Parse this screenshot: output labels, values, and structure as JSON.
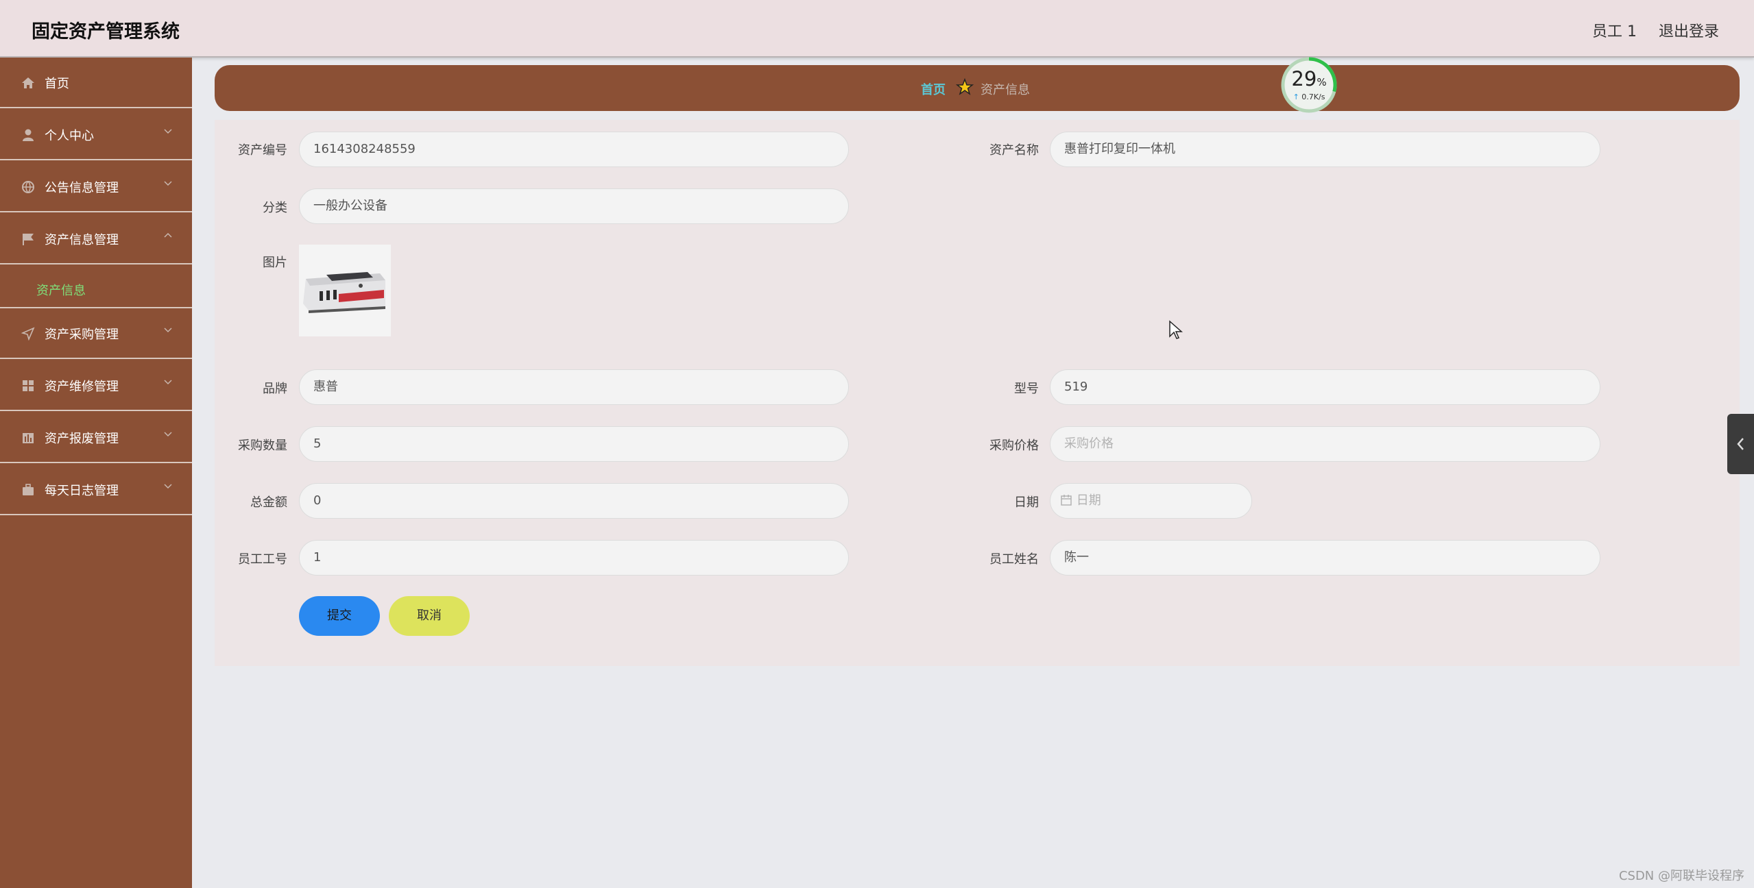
{
  "header": {
    "title": "固定资产管理系统",
    "user": "员工 1",
    "logout": "退出登录"
  },
  "sidebar": {
    "items": [
      {
        "label": "首页",
        "icon": "home-icon"
      },
      {
        "label": "个人中心",
        "icon": "user-icon"
      },
      {
        "label": "公告信息管理",
        "icon": "globe-icon"
      },
      {
        "label": "资产信息管理",
        "icon": "flag-icon",
        "expanded": true
      },
      {
        "label": "资产采购管理",
        "icon": "send-icon"
      },
      {
        "label": "资产维修管理",
        "icon": "grid-icon"
      },
      {
        "label": "资产报废管理",
        "icon": "chart-icon"
      },
      {
        "label": "每天日志管理",
        "icon": "briefcase-icon"
      }
    ],
    "sub_item": "资产信息"
  },
  "breadcrumb": {
    "home": "首页",
    "current": "资产信息"
  },
  "speed_widget": {
    "percent": "29",
    "unit": "%",
    "rate": "0.7K/s"
  },
  "form": {
    "asset_no": {
      "label": "资产编号",
      "value": "1614308248559"
    },
    "asset_name": {
      "label": "资产名称",
      "value": "惠普打印复印一体机"
    },
    "category": {
      "label": "分类",
      "value": "一般办公设备"
    },
    "picture": {
      "label": "图片"
    },
    "brand": {
      "label": "品牌",
      "value": "惠普"
    },
    "model": {
      "label": "型号",
      "value": "519"
    },
    "quantity": {
      "label": "采购数量",
      "value": "5"
    },
    "price": {
      "label": "采购价格",
      "placeholder": "采购价格"
    },
    "total": {
      "label": "总金额",
      "value": "0"
    },
    "date": {
      "label": "日期",
      "placeholder": "日期"
    },
    "employee_no": {
      "label": "员工工号",
      "value": "1"
    },
    "employee_name": {
      "label": "员工姓名",
      "value": "陈一"
    },
    "submit": "提交",
    "cancel": "取消"
  },
  "watermark": "CSDN @阿联毕设程序",
  "colors": {
    "sidebar": "#8b5035",
    "header": "#ecdfe1",
    "panel": "#ede5e6",
    "submit": "#2a89f0",
    "cancel": "#dde35c",
    "active": "#7fe07a"
  }
}
